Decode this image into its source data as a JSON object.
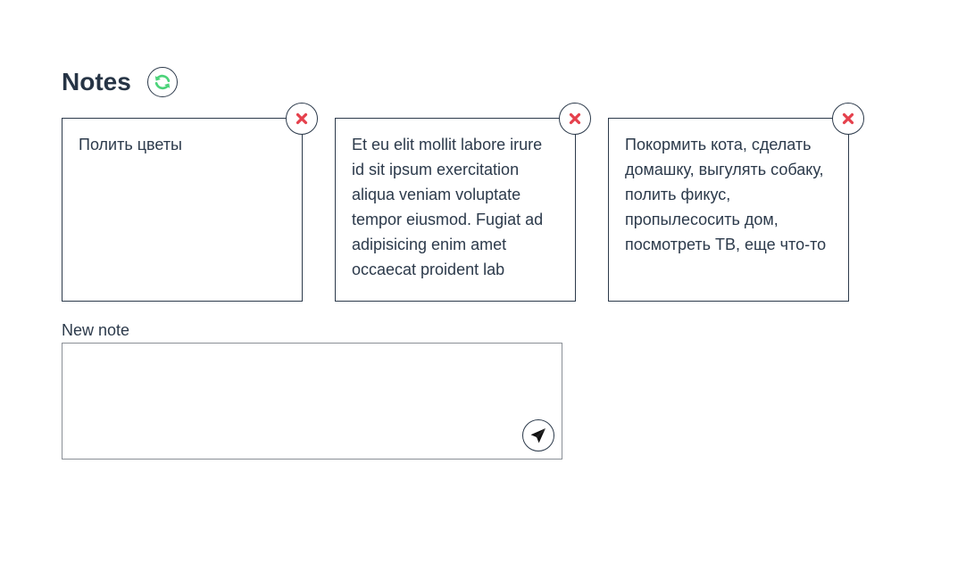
{
  "header": {
    "title": "Notes",
    "refresh_icon": "refresh-icon"
  },
  "notes": [
    {
      "text": "Полить цветы"
    },
    {
      "text": "Et eu elit mollit labore irure id sit ipsum exercitation aliqua veniam voluptate tempor eiusmod. Fugiat ad adipisicing enim amet occaecat proident lab"
    },
    {
      "text": "Покормить кота, сделать домашку, выгулять собаку, полить фикус, пропылесосить дом, посмотреть ТВ, еще что-то"
    }
  ],
  "new_note": {
    "label": "New note",
    "value": "",
    "placeholder": "",
    "send_icon": "paper-plane-icon"
  },
  "colors": {
    "text": "#2c3a4b",
    "refresh_accent": "#4cd37a",
    "delete_accent": "#e5404c",
    "border": "#2c3a4b"
  }
}
